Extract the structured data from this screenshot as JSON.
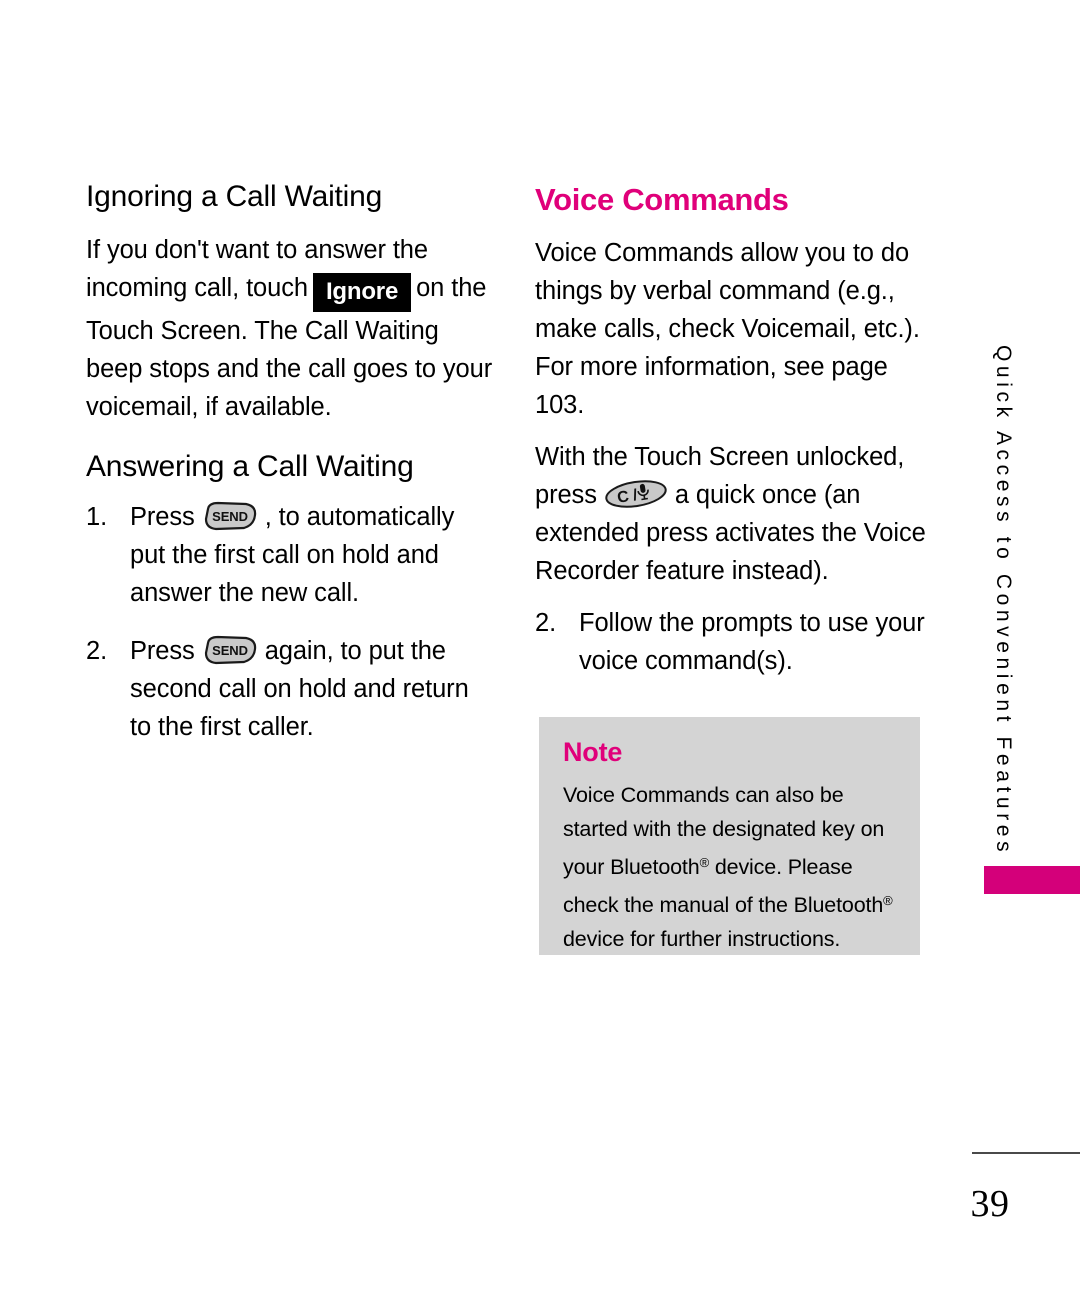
{
  "page": {
    "number": "39",
    "side_tab_label": "Quick Access to Convenient Features",
    "accent_color": "#E0007A",
    "tab_bar_color": "#D4007A"
  },
  "left_column": {
    "heading_1": "Ignoring a Call Waiting",
    "paragraph_1_part_a": "If you don't want to answer the incoming call, touch",
    "ignore_badge": "Ignore",
    "paragraph_1_part_b": "on the Touch Screen. The Call Waiting beep stops and the call goes to your voicemail, if available.",
    "heading_2": "Answering a Call Waiting",
    "steps": [
      {
        "number": "1.",
        "text_before_key": "Press",
        "key_icon": "send-key-icon",
        "key_label": "SEND",
        "text_after_key": ", to automatically put the first call on hold and answer the new call."
      },
      {
        "number": "2.",
        "text_before_key": "Press",
        "key_icon": "send-key-icon",
        "key_label": "SEND",
        "text_after_key": "again, to put the second call on hold and return to the first caller."
      }
    ]
  },
  "right_column": {
    "heading_1": "Voice Commands",
    "paragraph_1": "Voice Commands allow you to do things by verbal command (e.g., make calls, check Voicemail, etc.). For more information, see page 103.",
    "instruction": {
      "text_before_key": "With the Touch Screen unlocked, press",
      "key_icon": "clear-voice-key-icon",
      "key_label": "C /",
      "text_after_key": "a quick once (an extended press activates the Voice Recorder feature instead)."
    },
    "step_2": {
      "number": "2.",
      "text": "Follow the prompts to use your voice command(s)."
    }
  },
  "note": {
    "title": "Note",
    "line_1": "Voice Commands can also be started",
    "line_2": "with the designated key on your",
    "line_3_a": "Bluetooth",
    "line_3_sup": "®",
    "line_3_b": " device. Please check the",
    "line_4_a": "manual of the Bluetooth",
    "line_4_sup": "®",
    "line_4_b": " device for",
    "line_5": "further instructions."
  }
}
